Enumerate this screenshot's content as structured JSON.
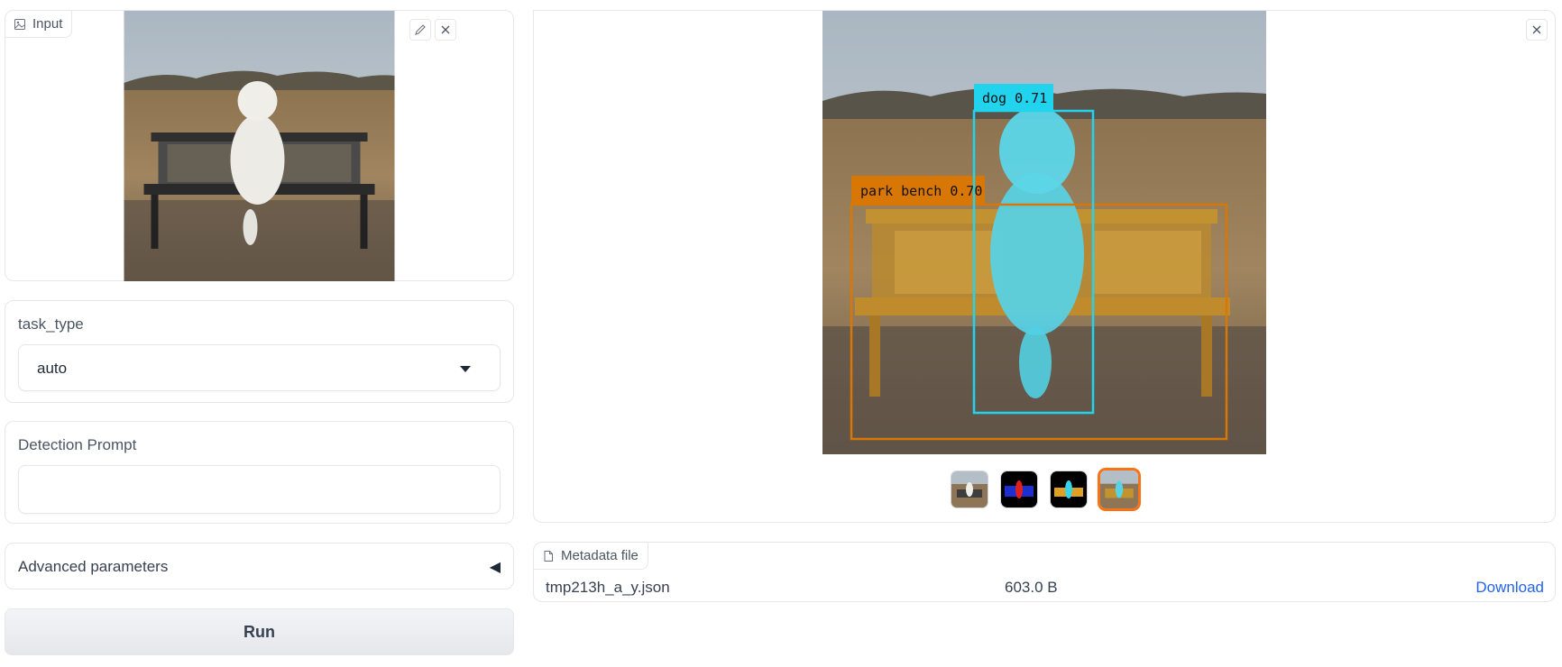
{
  "input_panel": {
    "tag_label": "Input",
    "tag_icon": "image-icon",
    "edit_icon": "pencil-icon",
    "clear_icon": "close-icon"
  },
  "task_type": {
    "label": "task_type",
    "value": "auto"
  },
  "detection_prompt": {
    "label": "Detection Prompt",
    "value": ""
  },
  "advanced": {
    "label": "Advanced parameters",
    "toggle_glyph": "◀"
  },
  "run_button": {
    "label": "Run"
  },
  "output": {
    "clear_icon": "close-icon",
    "detections": [
      {
        "label": "dog 0.71",
        "color": "#22d3ee"
      },
      {
        "label": "park bench 0.70",
        "color": "#d97706"
      }
    ],
    "thumbnails": [
      "original",
      "mask-blue-red",
      "mask-cyan-orange",
      "overlay"
    ],
    "selected_thumbnail": 3
  },
  "metadata": {
    "tag_label": "Metadata file",
    "tag_icon": "file-icon",
    "filename": "tmp213h_a_y.json",
    "size": "603.0 B",
    "download_label": "Download"
  },
  "colors": {
    "accent_orange": "#f97316",
    "link_blue": "#2563eb"
  }
}
